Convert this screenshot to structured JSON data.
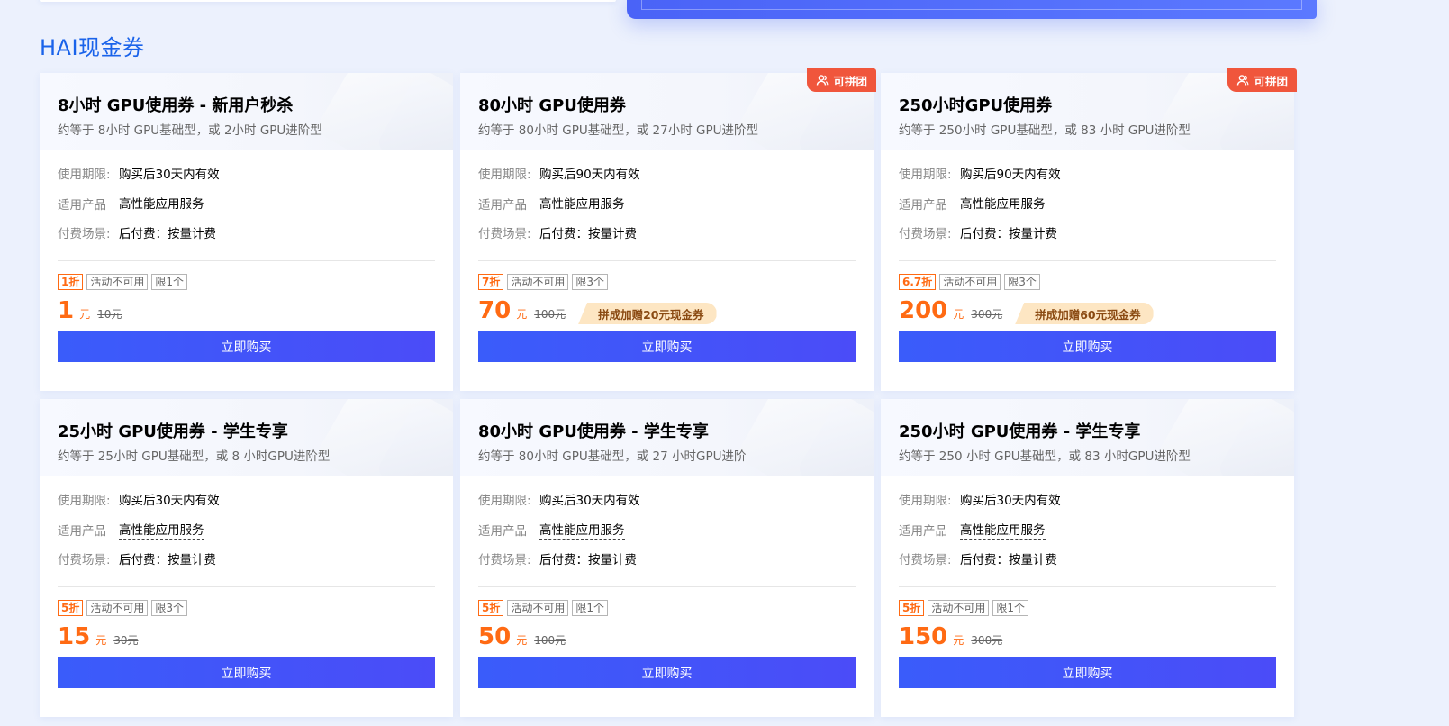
{
  "section": {
    "title": "HAI现金券"
  },
  "labels": {
    "period": "使用期限:",
    "product": "适用产品",
    "pay": "付费场景:",
    "yuan": "元",
    "buy": "立即购买",
    "group": "可拼团"
  },
  "cards": [
    {
      "title": "8小时 GPU使用券 - 新用户秒杀",
      "subtitle": "约等于 8小时 GPU基础型，或 2小时 GPU进阶型",
      "period": "购买后30天内有效",
      "product": "高性能应用服务",
      "pay": "后付费：按量计费",
      "discount": "1折",
      "activity": "活动不可用",
      "limit": "限1个",
      "price": "1",
      "original": "10元",
      "bonus": "",
      "group": false
    },
    {
      "title": "80小时 GPU使用券",
      "subtitle": "约等于 80小时 GPU基础型，或 27小时 GPU进阶型",
      "period": "购买后90天内有效",
      "product": "高性能应用服务",
      "pay": "后付费：按量计费",
      "discount": "7折",
      "activity": "活动不可用",
      "limit": "限3个",
      "price": "70",
      "original": "100元",
      "bonus": "拼成加赠20元现金券",
      "group": true
    },
    {
      "title": "250小时GPU使用券",
      "subtitle": "约等于 250小时 GPU基础型，或 83 小时 GPU进阶型",
      "period": "购买后90天内有效",
      "product": "高性能应用服务",
      "pay": "后付费：按量计费",
      "discount": "6.7折",
      "activity": "活动不可用",
      "limit": "限3个",
      "price": "200",
      "original": "300元",
      "bonus": "拼成加赠60元现金券",
      "group": true
    },
    {
      "title": "25小时 GPU使用券 - 学生专享",
      "subtitle": "约等于 25小时 GPU基础型，或 8 小时GPU进阶型",
      "period": "购买后30天内有效",
      "product": "高性能应用服务",
      "pay": "后付费：按量计费",
      "discount": "5折",
      "activity": "活动不可用",
      "limit": "限3个",
      "price": "15",
      "original": "30元",
      "bonus": "",
      "group": false
    },
    {
      "title": "80小时 GPU使用券 - 学生专享",
      "subtitle": "约等于 80小时 GPU基础型，或 27 小时GPU进阶",
      "period": "购买后30天内有效",
      "product": "高性能应用服务",
      "pay": "后付费：按量计费",
      "discount": "5折",
      "activity": "活动不可用",
      "limit": "限1个",
      "price": "50",
      "original": "100元",
      "bonus": "",
      "group": false
    },
    {
      "title": "250小时 GPU使用券 - 学生专享",
      "subtitle": "约等于 250 小时 GPU基础型，或 83 小时GPU进阶型",
      "period": "购买后30天内有效",
      "product": "高性能应用服务",
      "pay": "后付费：按量计费",
      "discount": "5折",
      "activity": "活动不可用",
      "limit": "限1个",
      "price": "150",
      "original": "300元",
      "bonus": "",
      "group": false
    }
  ]
}
